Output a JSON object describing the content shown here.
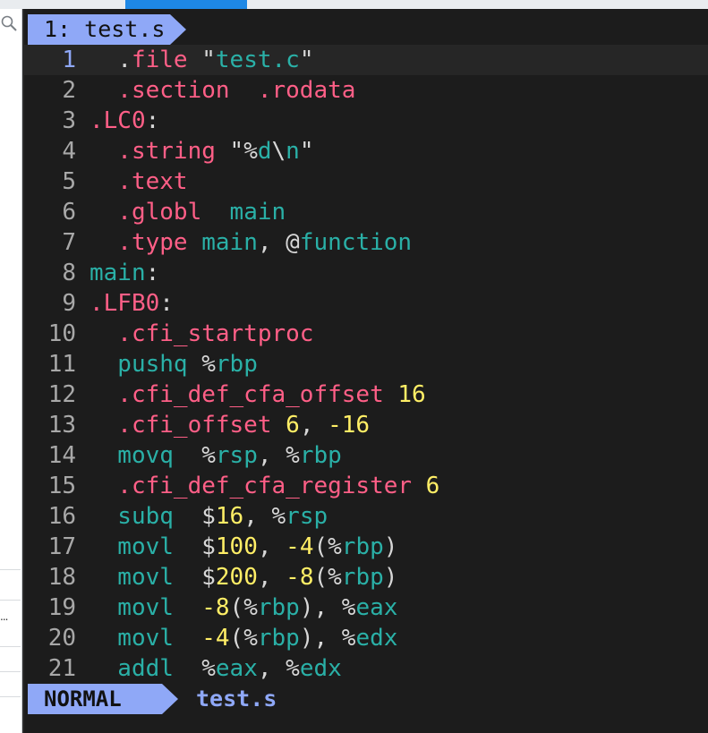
{
  "host": {
    "tab_1_label": "",
    "tab_2_label": "",
    "sidebar_more": "..."
  },
  "editor": {
    "tab_label": "1: test.s",
    "mode": "NORMAL",
    "status_filename": "test.s",
    "cursor_line": 1,
    "lines": [
      {
        "n": "1",
        "tokens": [
          {
            "t": "  ",
            "c": "plain"
          },
          {
            "t": ".",
            "c": "cursor"
          },
          {
            "t": "file",
            "c": "dir"
          },
          {
            "t": " \"",
            "c": "str"
          },
          {
            "t": "test.c",
            "c": "strin"
          },
          {
            "t": "\"",
            "c": "str"
          }
        ]
      },
      {
        "n": "2",
        "tokens": [
          {
            "t": "  .section  .rodata",
            "c": "dir"
          }
        ]
      },
      {
        "n": "3",
        "tokens": [
          {
            "t": ".LC0",
            "c": "dir"
          },
          {
            "t": ":",
            "c": "plain"
          }
        ]
      },
      {
        "n": "4",
        "tokens": [
          {
            "t": "  .string",
            "c": "dir"
          },
          {
            "t": " \"%",
            "c": "str"
          },
          {
            "t": "d",
            "c": "strin"
          },
          {
            "t": "\\",
            "c": "str"
          },
          {
            "t": "n",
            "c": "strin"
          },
          {
            "t": "\"",
            "c": "str"
          }
        ]
      },
      {
        "n": "5",
        "tokens": [
          {
            "t": "  .text",
            "c": "dir"
          }
        ]
      },
      {
        "n": "6",
        "tokens": [
          {
            "t": "  .globl",
            "c": "dir"
          },
          {
            "t": "  main",
            "c": "ins"
          }
        ]
      },
      {
        "n": "7",
        "tokens": [
          {
            "t": "  .type",
            "c": "dir"
          },
          {
            "t": " main",
            "c": "ins"
          },
          {
            "t": ", @",
            "c": "plain"
          },
          {
            "t": "function",
            "c": "ins"
          }
        ]
      },
      {
        "n": "8",
        "tokens": [
          {
            "t": "main",
            "c": "ins"
          },
          {
            "t": ":",
            "c": "plain"
          }
        ]
      },
      {
        "n": "9",
        "tokens": [
          {
            "t": ".LFB0",
            "c": "dir"
          },
          {
            "t": ":",
            "c": "plain"
          }
        ]
      },
      {
        "n": "10",
        "tokens": [
          {
            "t": "  .cfi_startproc",
            "c": "dir"
          }
        ]
      },
      {
        "n": "11",
        "tokens": [
          {
            "t": "  pushq",
            "c": "ins"
          },
          {
            "t": " %",
            "c": "plain"
          },
          {
            "t": "rbp",
            "c": "reg"
          }
        ]
      },
      {
        "n": "12",
        "tokens": [
          {
            "t": "  .cfi_def_cfa_offset",
            "c": "dir"
          },
          {
            "t": " 16",
            "c": "num"
          }
        ]
      },
      {
        "n": "13",
        "tokens": [
          {
            "t": "  .cfi_offset",
            "c": "dir"
          },
          {
            "t": " 6",
            "c": "num"
          },
          {
            "t": ", ",
            "c": "plain"
          },
          {
            "t": "-16",
            "c": "num"
          }
        ]
      },
      {
        "n": "14",
        "tokens": [
          {
            "t": "  movq",
            "c": "ins"
          },
          {
            "t": "  %",
            "c": "plain"
          },
          {
            "t": "rsp",
            "c": "reg"
          },
          {
            "t": ", %",
            "c": "plain"
          },
          {
            "t": "rbp",
            "c": "reg"
          }
        ]
      },
      {
        "n": "15",
        "tokens": [
          {
            "t": "  .cfi_def_cfa_register",
            "c": "dir"
          },
          {
            "t": " 6",
            "c": "num"
          }
        ]
      },
      {
        "n": "16",
        "tokens": [
          {
            "t": "  subq",
            "c": "ins"
          },
          {
            "t": "  $",
            "c": "plain"
          },
          {
            "t": "16",
            "c": "num"
          },
          {
            "t": ", %",
            "c": "plain"
          },
          {
            "t": "rsp",
            "c": "reg"
          }
        ]
      },
      {
        "n": "17",
        "tokens": [
          {
            "t": "  movl",
            "c": "ins"
          },
          {
            "t": "  $",
            "c": "plain"
          },
          {
            "t": "100",
            "c": "num"
          },
          {
            "t": ", ",
            "c": "plain"
          },
          {
            "t": "-4",
            "c": "num"
          },
          {
            "t": "(%",
            "c": "plain"
          },
          {
            "t": "rbp",
            "c": "reg"
          },
          {
            "t": ")",
            "c": "plain"
          }
        ]
      },
      {
        "n": "18",
        "tokens": [
          {
            "t": "  movl",
            "c": "ins"
          },
          {
            "t": "  $",
            "c": "plain"
          },
          {
            "t": "200",
            "c": "num"
          },
          {
            "t": ", ",
            "c": "plain"
          },
          {
            "t": "-8",
            "c": "num"
          },
          {
            "t": "(%",
            "c": "plain"
          },
          {
            "t": "rbp",
            "c": "reg"
          },
          {
            "t": ")",
            "c": "plain"
          }
        ]
      },
      {
        "n": "19",
        "tokens": [
          {
            "t": "  movl",
            "c": "ins"
          },
          {
            "t": "  ",
            "c": "plain"
          },
          {
            "t": "-8",
            "c": "num"
          },
          {
            "t": "(%",
            "c": "plain"
          },
          {
            "t": "rbp",
            "c": "reg"
          },
          {
            "t": "), %",
            "c": "plain"
          },
          {
            "t": "eax",
            "c": "reg"
          }
        ]
      },
      {
        "n": "20",
        "tokens": [
          {
            "t": "  movl",
            "c": "ins"
          },
          {
            "t": "  ",
            "c": "plain"
          },
          {
            "t": "-4",
            "c": "num"
          },
          {
            "t": "(%",
            "c": "plain"
          },
          {
            "t": "rbp",
            "c": "reg"
          },
          {
            "t": "), %",
            "c": "plain"
          },
          {
            "t": "edx",
            "c": "reg"
          }
        ]
      },
      {
        "n": "21",
        "tokens": [
          {
            "t": "  addl",
            "c": "ins"
          },
          {
            "t": "  %",
            "c": "plain"
          },
          {
            "t": "eax",
            "c": "reg"
          },
          {
            "t": ", %",
            "c": "plain"
          },
          {
            "t": "edx",
            "c": "reg"
          }
        ]
      }
    ]
  },
  "colors": {
    "accent": "#8fa8f7",
    "directive": "#ff5f87",
    "instruction": "#2ab0a7",
    "number": "#ffee66",
    "cursor": "#00ff3c",
    "background": "#1c1c1c"
  }
}
